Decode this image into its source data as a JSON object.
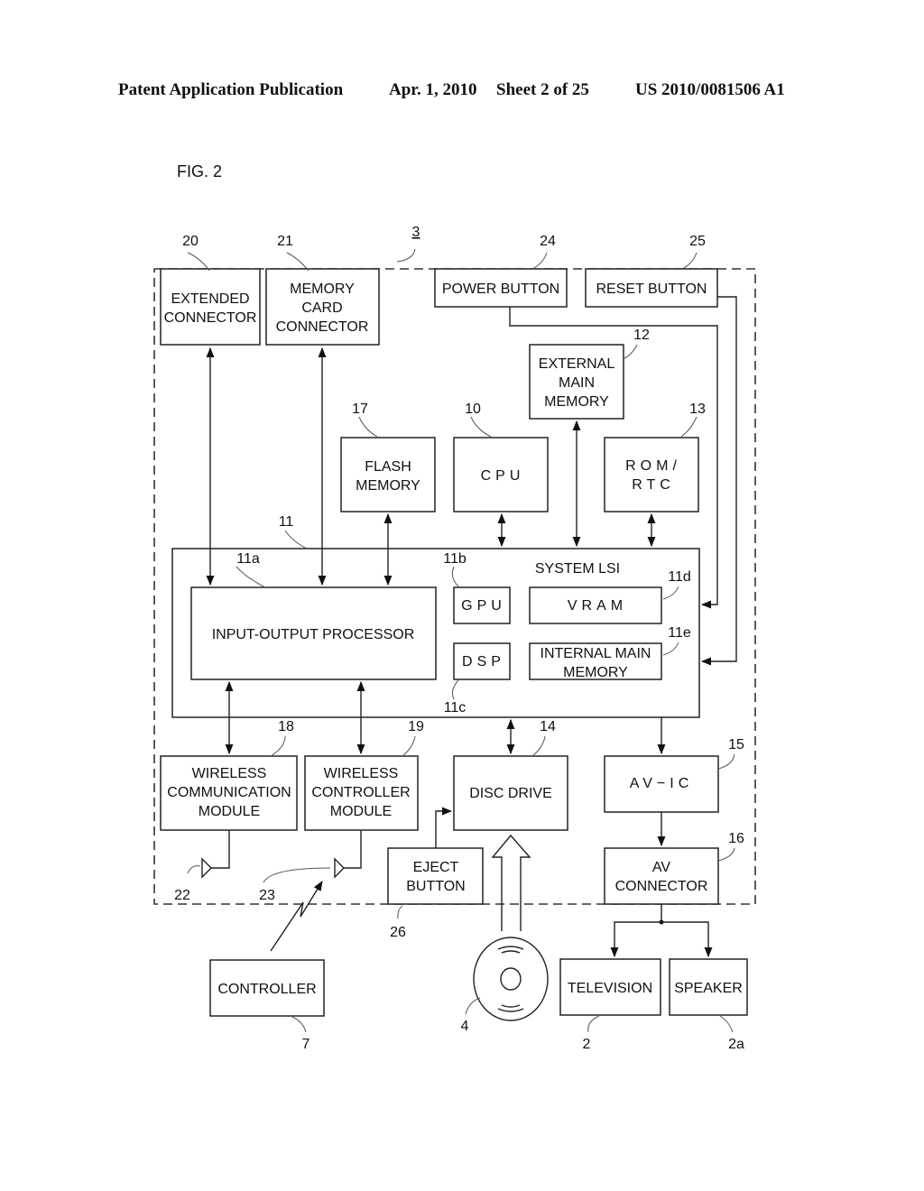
{
  "header": {
    "publication": "Patent Application Publication",
    "date": "Apr. 1, 2010",
    "sheet": "Sheet 2 of 25",
    "number": "US 2010/0081506 A1"
  },
  "figure_label": "FIG. 2",
  "blocks": {
    "extended_connector": {
      "lines": [
        "EXTENDED",
        "CONNECTOR"
      ],
      "ref": "20"
    },
    "memory_card_connector": {
      "lines": [
        "MEMORY",
        "CARD",
        "CONNECTOR"
      ],
      "ref": "21"
    },
    "power_button": {
      "lines": [
        "POWER BUTTON"
      ],
      "ref": "24"
    },
    "reset_button": {
      "lines": [
        "RESET BUTTON"
      ],
      "ref": "25"
    },
    "external_main_memory": {
      "lines": [
        "EXTERNAL",
        "MAIN",
        "MEMORY"
      ],
      "ref": "12"
    },
    "flash_memory": {
      "lines": [
        "FLASH",
        "MEMORY"
      ],
      "ref": "17"
    },
    "cpu": {
      "lines": [
        "CPU"
      ],
      "ref": "10"
    },
    "rom_rtc": {
      "lines": [
        "ROM/",
        "RTC"
      ],
      "ref": "13"
    },
    "system_lsi": {
      "lines": [
        "SYSTEM LSI"
      ],
      "ref": "11"
    },
    "io_processor": {
      "lines": [
        "INPUT-OUTPUT PROCESSOR"
      ],
      "ref": "11a"
    },
    "gpu": {
      "lines": [
        "GPU"
      ],
      "ref": "11b"
    },
    "dsp": {
      "lines": [
        "DSP"
      ],
      "ref": "11c"
    },
    "vram": {
      "lines": [
        "VRAM"
      ],
      "ref": "11d"
    },
    "internal_main_memory": {
      "lines": [
        "INTERNAL MAIN",
        "MEMORY"
      ],
      "ref": "11e"
    },
    "wireless_comm_module": {
      "lines": [
        "WIRELESS",
        "COMMUNICATION",
        "MODULE"
      ],
      "ref": "18"
    },
    "wireless_controller_module": {
      "lines": [
        "WIRELESS",
        "CONTROLLER",
        "MODULE"
      ],
      "ref": "19"
    },
    "disc_drive": {
      "lines": [
        "DISC DRIVE"
      ],
      "ref": "14"
    },
    "av_ic": {
      "lines": [
        "AV−IC"
      ],
      "ref": "15"
    },
    "eject_button": {
      "lines": [
        "EJECT",
        "BUTTON"
      ],
      "ref": "26"
    },
    "av_connector": {
      "lines": [
        "AV",
        "CONNECTOR"
      ],
      "ref": "16"
    },
    "controller": {
      "lines": [
        "CONTROLLER"
      ],
      "ref": "7"
    },
    "television": {
      "lines": [
        "TELEVISION"
      ],
      "ref": "2"
    },
    "speaker": {
      "lines": [
        "SPEAKER"
      ],
      "ref": "2a"
    }
  },
  "refs": {
    "game_apparatus": "3",
    "antenna_22": "22",
    "antenna_23": "23",
    "optical_disc": "4"
  }
}
